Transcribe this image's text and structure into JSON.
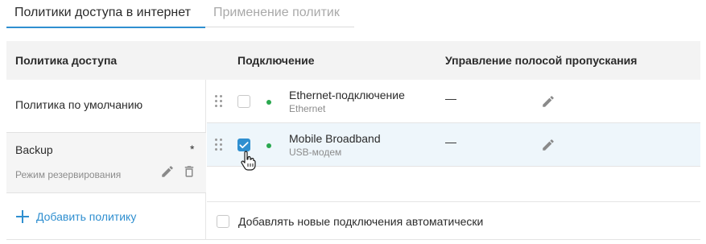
{
  "tabs": {
    "active": "Политики доступа в интернет",
    "inactive": "Применение политик"
  },
  "table_headers": {
    "policy": "Политика доступа",
    "connection": "Подключение",
    "bandwidth": "Управление полосой пропускания"
  },
  "policies": [
    {
      "name": "Политика по умолчанию"
    },
    {
      "name": "Backup",
      "subtitle": "Режим резервирования",
      "modified_marker": "*"
    }
  ],
  "add_policy_label": "Добавить политику",
  "connections": [
    {
      "name": "Ethernet-подключение",
      "type": "Ethernet",
      "checked": false,
      "status_color": "#2aa84f",
      "bandwidth": "—"
    },
    {
      "name": "Mobile Broadband",
      "type": "USB-модем",
      "checked": true,
      "status_color": "#2aa84f",
      "bandwidth": "—"
    }
  ],
  "auto_add_label": "Добавлять новые подключения автоматически",
  "colors": {
    "accent": "#2f8fd0",
    "status_online": "#2aa84f",
    "selected_row": "#eef6fb",
    "header_bg": "#f3f3f3"
  },
  "icons": {
    "drag": "drag-handle-icon",
    "edit": "pencil-icon",
    "delete": "trash-icon",
    "add": "plus-icon",
    "cursor": "hand-pointer-icon",
    "check": "checkmark-icon"
  }
}
